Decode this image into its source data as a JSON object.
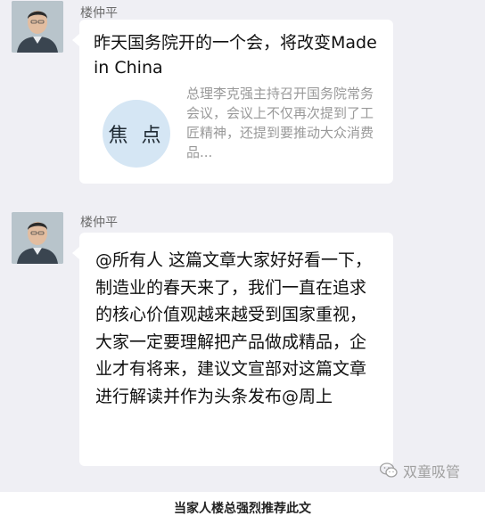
{
  "messages": [
    {
      "sender": "楼仲平",
      "title": "昨天国务院开的一个会，将改变Made in China",
      "thumb_text": "焦 点",
      "description": "总理李克强主持召开国务院常务会议，会议上不仅再次提到了工匠精神，还提到要推动大众消费品..."
    },
    {
      "sender": "楼仲平",
      "text": "@所有人 这篇文章大家好好看一下，制造业的春天来了，我们一直在追求的核心价值观越来越受到国家重视，大家一定要理解把产品做成精品，企业才有将来，建议文宣部对这篇文章进行解读并作为头条发布@周上"
    }
  ],
  "watermark": "双童吸管",
  "caption": "当家人楼总强烈推荐此文"
}
